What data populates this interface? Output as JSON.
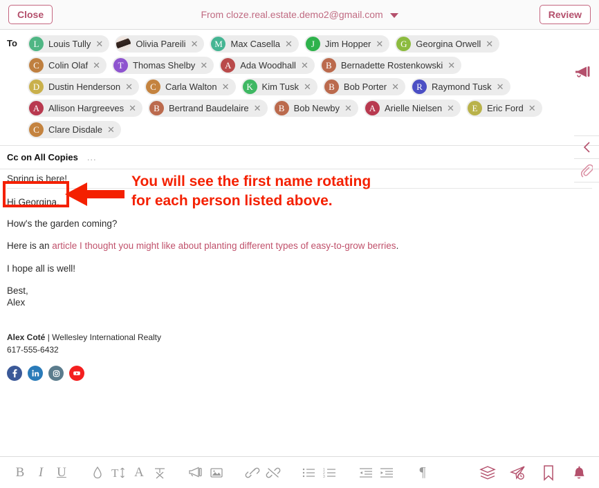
{
  "header": {
    "close_label": "Close",
    "from_text": "From cloze.real.estate.demo2@gmail.com",
    "review_label": "Review",
    "accent_color": "#b4506c"
  },
  "recipients": {
    "to_label": "To",
    "megaphone_icon": "megaphone-icon",
    "chips": [
      {
        "name": "Louis Tully",
        "initial": "L",
        "color": "#4fb684",
        "photo": false
      },
      {
        "name": "Olivia Pareili",
        "initial": "O",
        "color": "#cccccc",
        "photo": true
      },
      {
        "name": "Max Casella",
        "initial": "M",
        "color": "#45b593",
        "photo": false
      },
      {
        "name": "Jim Hopper",
        "initial": "J",
        "color": "#2eb24c",
        "photo": false
      },
      {
        "name": "Georgina Orwell",
        "initial": "G",
        "color": "#8cbb3f",
        "photo": false
      },
      {
        "name": "Colin Olaf",
        "initial": "C",
        "color": "#bf7f3f",
        "photo": false
      },
      {
        "name": "Thomas Shelby",
        "initial": "T",
        "color": "#8e54cf",
        "photo": false
      },
      {
        "name": "Ada Woodhall",
        "initial": "A",
        "color": "#b94a4a",
        "photo": false
      },
      {
        "name": "Bernadette Rostenkowski",
        "initial": "B",
        "color": "#bb6a4d",
        "photo": false
      },
      {
        "name": "Dustin Henderson",
        "initial": "D",
        "color": "#c9b04b",
        "photo": false
      },
      {
        "name": "Carla Walton",
        "initial": "C",
        "color": "#c4833f",
        "photo": false
      },
      {
        "name": "Kim Tusk",
        "initial": "K",
        "color": "#3fb863",
        "photo": false
      },
      {
        "name": "Bob Porter",
        "initial": "B",
        "color": "#bb6a4d",
        "photo": false
      },
      {
        "name": "Raymond Tusk",
        "initial": "R",
        "color": "#4b4fc4",
        "photo": false
      },
      {
        "name": "Allison Hargreeves",
        "initial": "A",
        "color": "#b8394f",
        "photo": false
      },
      {
        "name": "Bertrand Baudelaire",
        "initial": "B",
        "color": "#bb6a4d",
        "photo": false
      },
      {
        "name": "Bob Newby",
        "initial": "B",
        "color": "#bb6a4d",
        "photo": false
      },
      {
        "name": "Arielle Nielsen",
        "initial": "A",
        "color": "#b8394f",
        "photo": false
      },
      {
        "name": "Eric Ford",
        "initial": "E",
        "color": "#b9b24a",
        "photo": false
      },
      {
        "name": "Clare Disdale",
        "initial": "C",
        "color": "#c4833f",
        "photo": false
      }
    ],
    "remove_label": "✕"
  },
  "cc": {
    "label": "Cc on All Copies",
    "dots": "..."
  },
  "message": {
    "subject": "Spring is here!",
    "greeting": "Hi Georgina,",
    "line_garden": "How's the garden coming?",
    "line_article_prefix": "Here is an ",
    "line_article_link": "article I thought you might like about planting different types of easy-to-grow berries",
    "line_article_suffix": ".",
    "line_hope": "I hope all is well!",
    "closing": "Best,",
    "sender_first_name": "Alex",
    "signature": {
      "name": "Alex Coté",
      "separator": " | ",
      "company": "Wellesley International Realty",
      "phone": "617-555-6432",
      "socials": [
        {
          "name": "facebook-icon",
          "color": "#3b5998"
        },
        {
          "name": "linkedin-icon",
          "color": "#2a7bb9"
        },
        {
          "name": "instagram-icon",
          "color": "#5b7c8d"
        },
        {
          "name": "youtube-icon",
          "color": "#f41f1f"
        }
      ]
    }
  },
  "rail": {
    "collapse_icon": "chevron-left-icon",
    "attachment_icon": "paperclip-icon"
  },
  "annotation": {
    "text_line1": "You will see the first name rotating",
    "text_line2": "for each person listed above.",
    "color": "#f42000",
    "highlight_target": "Hi Georgina,"
  },
  "toolbar": {
    "left_items": [
      {
        "name": "bold-button",
        "glyph": "B",
        "style": "tb-b"
      },
      {
        "name": "italic-button",
        "glyph": "I",
        "style": "tb-i"
      },
      {
        "name": "underline-button",
        "glyph": "U",
        "style": "tb-u"
      }
    ],
    "format_items": [
      {
        "name": "text-color-button",
        "icon": "droplet-icon"
      },
      {
        "name": "font-size-button",
        "icon": "text-size-icon"
      },
      {
        "name": "font-family-button",
        "icon": "font-icon"
      },
      {
        "name": "clear-formatting-button",
        "icon": "clear-format-icon"
      }
    ],
    "insert_items": [
      {
        "name": "insert-template-button",
        "icon": "megaphone-icon"
      },
      {
        "name": "insert-image-button",
        "icon": "image-icon"
      }
    ],
    "link_items": [
      {
        "name": "insert-link-button",
        "icon": "link-icon"
      },
      {
        "name": "remove-link-button",
        "icon": "unlink-icon"
      }
    ],
    "list_items": [
      {
        "name": "bulleted-list-button",
        "icon": "bullet-list-icon"
      },
      {
        "name": "numbered-list-button",
        "icon": "numbered-list-icon"
      }
    ],
    "indent_items": [
      {
        "name": "outdent-button",
        "icon": "outdent-icon"
      },
      {
        "name": "indent-button",
        "icon": "indent-icon"
      }
    ],
    "paragraph_items": [
      {
        "name": "paragraph-button",
        "icon": "pilcrow-icon",
        "glyph": "¶"
      }
    ],
    "right_items": [
      {
        "name": "templates-button",
        "icon": "layers-icon"
      },
      {
        "name": "schedule-send-button",
        "icon": "send-later-icon"
      },
      {
        "name": "bookmark-button",
        "icon": "bookmark-icon"
      },
      {
        "name": "reminder-button",
        "icon": "bell-icon"
      }
    ]
  }
}
